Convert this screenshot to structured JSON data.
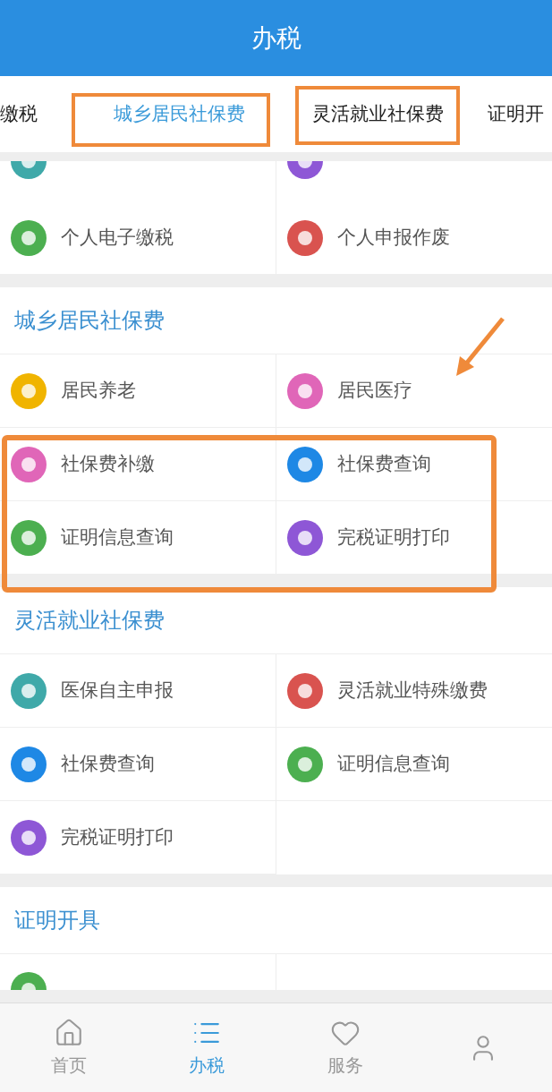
{
  "header": {
    "title": "办税"
  },
  "tabs": [
    {
      "label": "缴税",
      "selected": false
    },
    {
      "label": "城乡居民社保费",
      "selected": true
    },
    {
      "label": "灵活就业社保费",
      "selected": false
    },
    {
      "label": "证明开",
      "selected": false
    }
  ],
  "sections": [
    {
      "items": [
        {
          "kind": "clipped",
          "color": "#3fa9a9"
        },
        {
          "kind": "clipped",
          "color": "#8e57d6"
        },
        {
          "kind": "full",
          "label": "个人电子缴税",
          "color": "#4caf50"
        },
        {
          "kind": "full",
          "label": "个人申报作废",
          "color": "#d9534f"
        }
      ]
    },
    {
      "title": "城乡居民社保费",
      "items": [
        {
          "kind": "full",
          "label": "居民养老",
          "color": "#f0b400"
        },
        {
          "kind": "full",
          "label": "居民医疗",
          "color": "#e066b8"
        },
        {
          "kind": "full",
          "label": "社保费补缴",
          "color": "#e066b8"
        },
        {
          "kind": "full",
          "label": "社保费查询",
          "color": "#1e88e5"
        },
        {
          "kind": "full",
          "label": "证明信息查询",
          "color": "#4caf50"
        },
        {
          "kind": "full",
          "label": "完税证明打印",
          "color": "#8e57d6"
        }
      ]
    },
    {
      "title": "灵活就业社保费",
      "items": [
        {
          "kind": "full",
          "label": "医保自主申报",
          "color": "#3fa9a9"
        },
        {
          "kind": "full",
          "label": "灵活就业特殊缴费",
          "color": "#d9534f"
        },
        {
          "kind": "full",
          "label": "社保费查询",
          "color": "#1e88e5"
        },
        {
          "kind": "full",
          "label": "证明信息查询",
          "color": "#4caf50"
        },
        {
          "kind": "full",
          "label": "完税证明打印",
          "color": "#8e57d6"
        }
      ]
    },
    {
      "title": "证明开具",
      "items": [
        {
          "kind": "clipped_bottom",
          "color": "#4caf50"
        }
      ]
    }
  ],
  "bottom_nav": [
    {
      "label": "首页",
      "selected": false
    },
    {
      "label": "办税",
      "selected": true
    },
    {
      "label": "服务",
      "selected": false
    },
    {
      "selected": false
    }
  ]
}
